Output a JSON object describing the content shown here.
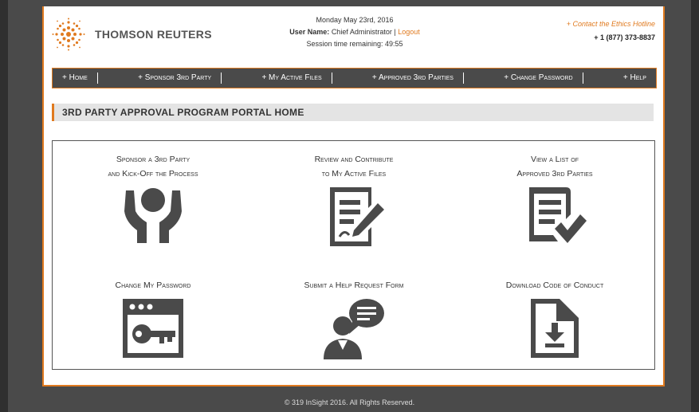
{
  "header": {
    "logo_text": "THOMSON REUTERS",
    "date": "Monday May 23rd, 2016",
    "user_label": "User Name:",
    "user_name": "Chief Administrator",
    "logout": "Logout",
    "session": "Session time remaining: 49:55",
    "ethics_link": "+ Contact the Ethics Hotline",
    "ethics_phone": "+ 1 (877) 373-8837"
  },
  "nav": [
    "+ Home",
    "+ Sponsor 3rd Party",
    "+ My Active Files",
    "+ Approved 3rd Parties",
    "+ Change Password",
    "+ Help"
  ],
  "section_title": "3RD PARTY APPROVAL PROGRAM PORTAL HOME",
  "tiles": [
    {
      "label": "Sponsor a 3rd Party\nand Kick-Off the Process",
      "icon": "hands-person-icon"
    },
    {
      "label": "Review and Contribute\nto My Active Files",
      "icon": "document-edit-icon"
    },
    {
      "label": "View a List of\nApproved 3rd Parties",
      "icon": "list-check-icon"
    },
    {
      "label": "Change My Password",
      "icon": "key-window-icon"
    },
    {
      "label": "Submit a Help Request Form",
      "icon": "person-chat-icon"
    },
    {
      "label": "Download Code of Conduct",
      "icon": "file-download-icon"
    }
  ],
  "footer": "© 319 InSight 2016. All Rights Reserved.",
  "colors": {
    "accent": "#e07a1f",
    "nav_bg": "#4a4a4a",
    "icon": "#4a4a4a"
  }
}
